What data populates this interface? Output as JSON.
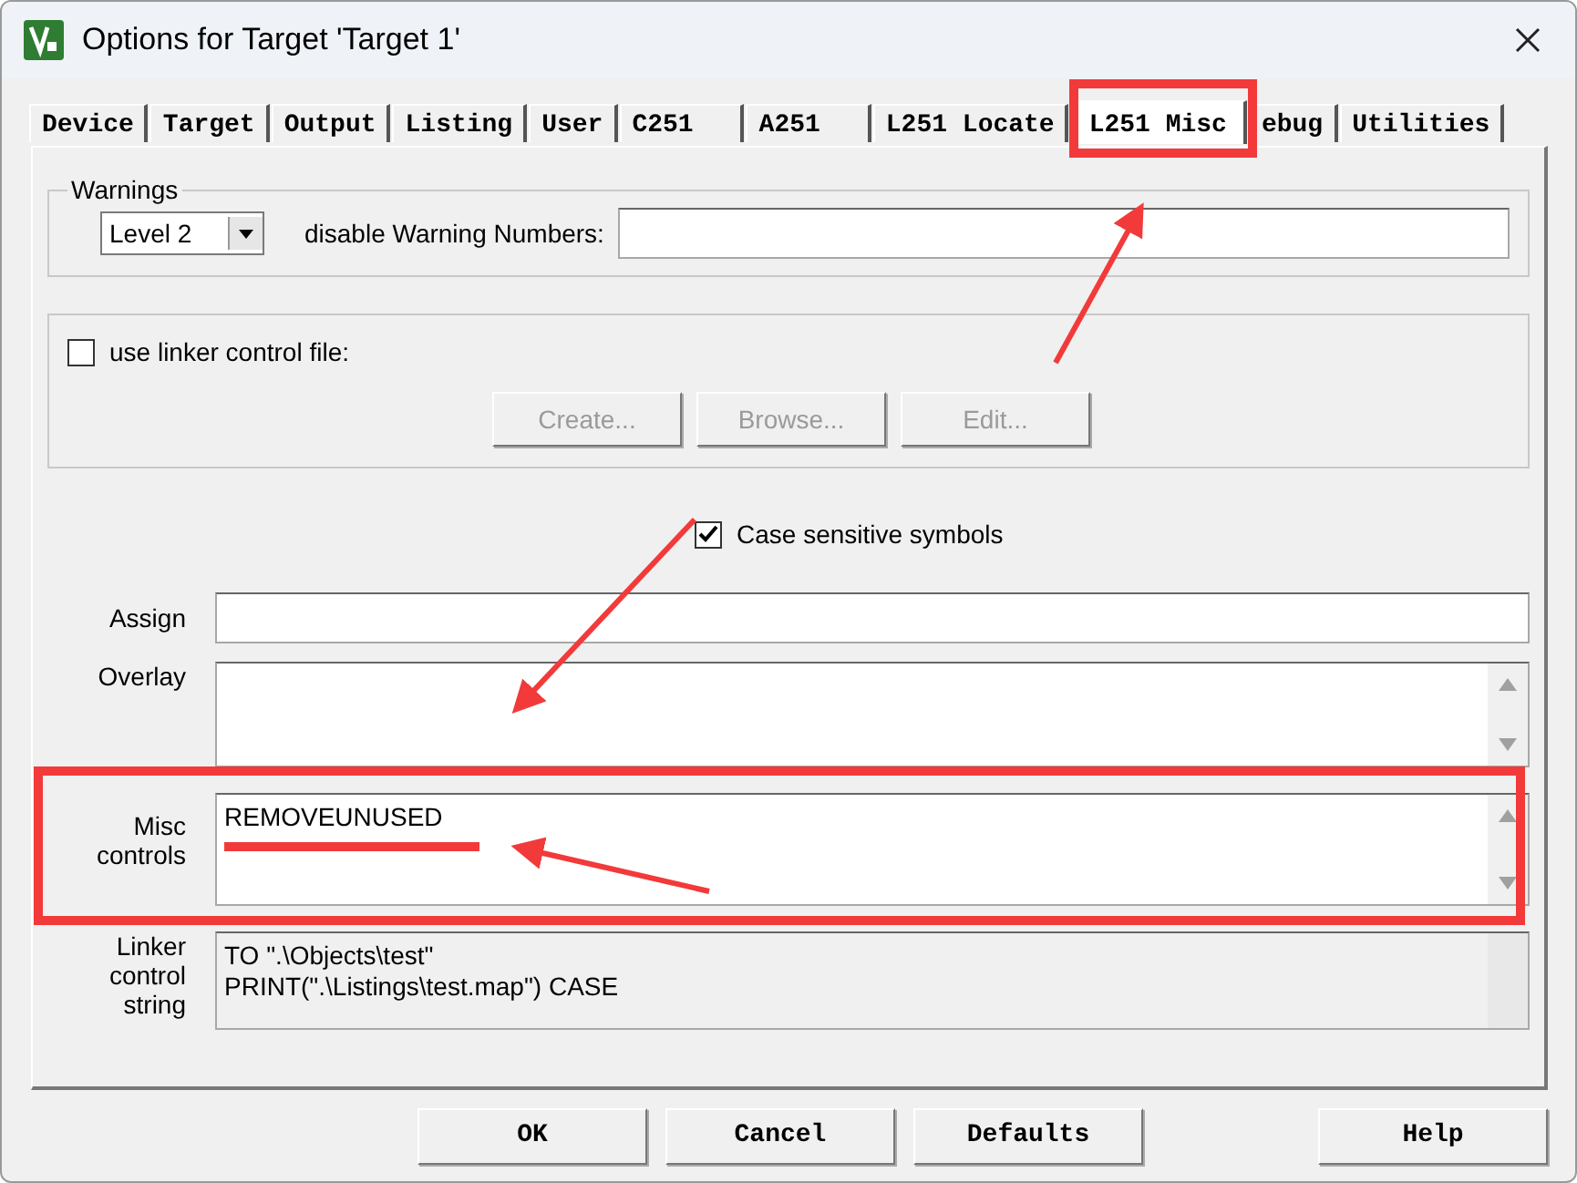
{
  "window": {
    "title": "Options for Target 'Target 1'"
  },
  "tabs": [
    {
      "label": "Device",
      "selected": false
    },
    {
      "label": "Target",
      "selected": false
    },
    {
      "label": "Output",
      "selected": false
    },
    {
      "label": "Listing",
      "selected": false
    },
    {
      "label": "User",
      "selected": false
    },
    {
      "label": "C251",
      "selected": false
    },
    {
      "label": "A251",
      "selected": false
    },
    {
      "label": "L251 Locate",
      "selected": false
    },
    {
      "label": "L251 Misc",
      "selected": true
    },
    {
      "label": "ebug",
      "selected": false
    },
    {
      "label": "Utilities",
      "selected": false
    }
  ],
  "warnings": {
    "title": "Warnings",
    "level": "Level 2",
    "disable_label": "disable Warning Numbers:"
  },
  "linker_file": {
    "label": "use linker control file:",
    "checked": false,
    "buttons": [
      {
        "label": "Create...",
        "disabled": true
      },
      {
        "label": "Browse...",
        "disabled": true
      },
      {
        "label": "Edit...",
        "disabled": true
      }
    ]
  },
  "case_sensitive": {
    "label": "Case sensitive symbols",
    "checked": true
  },
  "fields": [
    {
      "label": "Assign",
      "kind": "line"
    },
    {
      "label": "Overlay",
      "kind": "area"
    },
    {
      "label": "Misc controls",
      "kind": "area",
      "lines": [
        "REMOVEUNUSED"
      ]
    },
    {
      "label": "Linker control string",
      "kind": "readonly",
      "lines": [
        "TO \".\\Objects\\test\"",
        "PRINT(\".\\Listings\\test.map\") CASE"
      ]
    }
  ],
  "buttons": [
    "OK",
    "Cancel",
    "Defaults",
    "Help"
  ]
}
